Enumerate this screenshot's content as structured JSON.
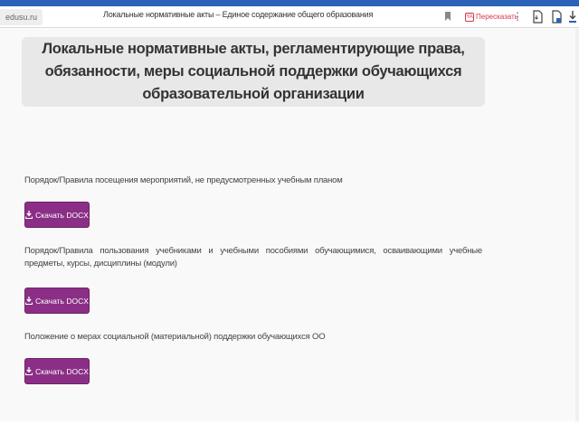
{
  "browser": {
    "domain": "edusu.ru",
    "page_title": "Локальные нормативные акты – Единое содержание общего образования",
    "retell_label": "Пересказать",
    "retell_badge": "YA",
    "menu_glyph": "⋮"
  },
  "main": {
    "heading": "Локальные нормативные акты, регламентирующие права, обязанности, меры социальной поддержки обучающихся образовательной организации",
    "documents": [
      {
        "label": "Порядок/Правила посещения мероприятий, не предусмотренных учебным планом",
        "button_label": "Скачать DOCX"
      },
      {
        "label": "Порядок/Правила пользования учебниками и учебными пособиями обучающимися, осваивающими учебные предметы, курсы, дисциплины (модули)",
        "button_label": "Скачать DOCX"
      },
      {
        "label": "Положение о мерах социальной (материальной) поддержки обучающихся ОО",
        "button_label": "Скачать DOCX"
      }
    ]
  },
  "colors": {
    "button_bg": "#8b2f86",
    "heading_bg": "#e8e8e8",
    "top_strip": "#2a63b8",
    "retell_accent": "#d4364a"
  }
}
